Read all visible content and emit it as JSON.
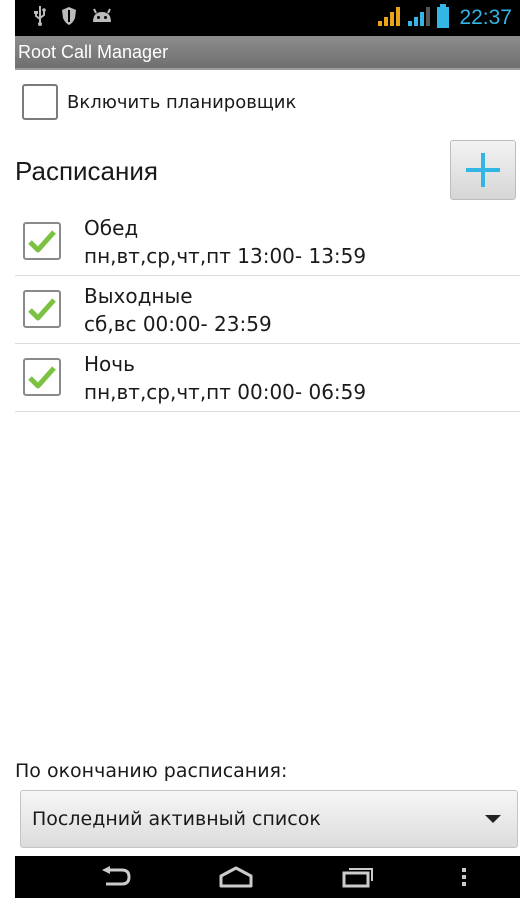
{
  "status_bar": {
    "icons_left": [
      "usb-icon",
      "shield-icon",
      "android-icon"
    ],
    "icons_right": [
      "signal-icon",
      "signal-icon",
      "battery-icon"
    ],
    "time": "22:37"
  },
  "app": {
    "title": "Root Call Manager"
  },
  "scheduler": {
    "enable_label": "Включить планировщик",
    "enabled": false
  },
  "schedules": {
    "title": "Расписания",
    "add_icon": "plus-icon",
    "items": [
      {
        "name": "Обед",
        "time": "пн,вт,ср,чт,пт 13:00- 13:59",
        "checked": true
      },
      {
        "name": "Выходные",
        "time": "сб,вс 00:00- 23:59",
        "checked": true
      },
      {
        "name": "Ночь",
        "time": "пн,вт,ср,чт,пт 00:00- 06:59",
        "checked": true
      }
    ]
  },
  "on_end": {
    "label": "По окончанию расписания:",
    "selected": "Последний активный список"
  },
  "nav": {
    "icons": [
      "back-icon",
      "home-icon",
      "recent-apps-icon",
      "menu-icon"
    ]
  },
  "colors": {
    "accent": "#33b5e5",
    "check": "#7cc242",
    "signal": "#e8a317"
  }
}
